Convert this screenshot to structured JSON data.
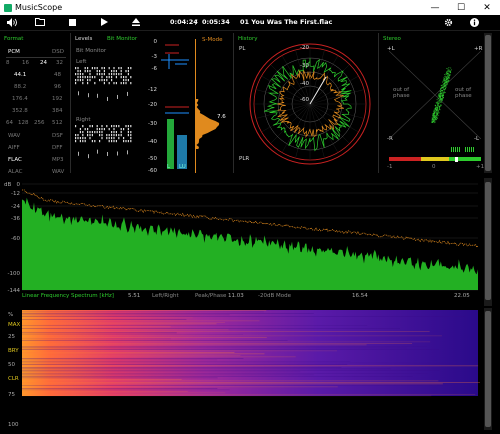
{
  "app": {
    "title": "MusicScope"
  },
  "window_controls": {
    "minimize": "—",
    "maximize": "☐",
    "close": "✕"
  },
  "toolbar": {
    "time_elapsed": "0:04:24",
    "separator": "/",
    "time_total": "0:05:34",
    "track": "01 You Was The First.flac"
  },
  "format": {
    "title": "Format",
    "row1": [
      "PCM",
      "DSD"
    ],
    "bits": [
      "8",
      "16",
      "24",
      "32"
    ],
    "rates": [
      [
        "44.1",
        "48"
      ],
      [
        "88.2",
        "96"
      ],
      [
        "176.4",
        "192"
      ],
      [
        "352.8",
        "384"
      ]
    ],
    "dsd_row": [
      "64",
      "128",
      "256",
      "512"
    ],
    "codecs": [
      [
        "WAV",
        "DSF"
      ],
      [
        "AIFF",
        "DFF"
      ],
      [
        "FLAC",
        "MP3"
      ],
      [
        "ALAC",
        "WAV"
      ]
    ]
  },
  "levels": {
    "title": "Levels",
    "bit_monitor_top": "Bit Monitor",
    "bit_monitor": "Bit Monitor",
    "left": "Left",
    "right": "Right",
    "scale": [
      "0",
      "-3",
      "-6",
      "-12",
      "-20",
      "-30",
      "-40",
      "-50",
      "-60"
    ],
    "s_mode": "S-Mode",
    "peak_value": "7.6",
    "labels": [
      "L",
      "LU"
    ]
  },
  "history": {
    "title": "History",
    "pl": "PL",
    "plr": "PLR",
    "rings": [
      "-20",
      "-30",
      "-40",
      "-60"
    ]
  },
  "stereo": {
    "title": "Stereo",
    "plus_l": "+L",
    "plus_r": "+R",
    "minus_r": "-R",
    "minus_l": "-L",
    "out_of_phase_left": "out of phase",
    "out_of_phase_right": "out of phase",
    "corr_labels": [
      "-1",
      "0",
      "+1"
    ]
  },
  "spectrum": {
    "y_unit": "dB",
    "y_ticks": [
      "0",
      "-12",
      "-24",
      "-36",
      "-60",
      "-100",
      "-144"
    ],
    "footer_title": "Linear Frequency Spectrum [kHz]",
    "footer_items": [
      "5.51",
      "Left/Right",
      "Peak/Phase",
      "11.03",
      "-20dB Mode",
      "16.54",
      "22.05"
    ]
  },
  "spectrogram": {
    "y_ticks": [
      "%",
      "MAX",
      "25",
      "BRY",
      "50",
      "CLR",
      "75",
      "100"
    ]
  },
  "colors": {
    "accent_green": "#2ecc2e",
    "accent_orange": "#e08a1e",
    "accent_red": "#cc2222"
  }
}
